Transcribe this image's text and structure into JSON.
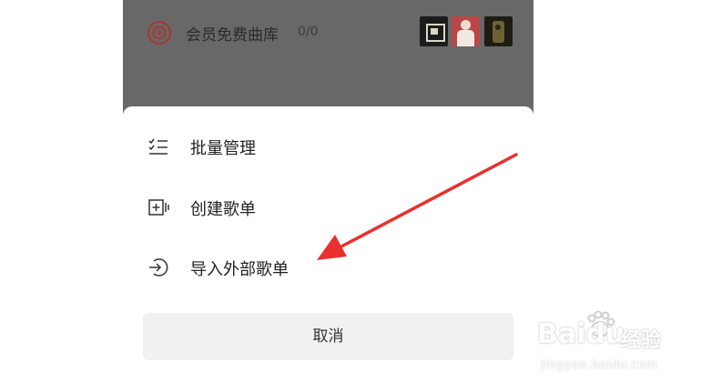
{
  "library": {
    "title": "会员免费曲库",
    "count": "0/0",
    "disc_icon": "vinyl-disc-icon",
    "accent_color": "#d9453a"
  },
  "menu": {
    "items": [
      {
        "label": "批量管理",
        "icon": "batch-manage-checklist-icon"
      },
      {
        "label": "创建歌单",
        "icon": "create-playlist-icon"
      },
      {
        "label": "导入外部歌单",
        "icon": "import-playlist-icon"
      }
    ],
    "cancel_label": "取消"
  },
  "annotation": {
    "arrow_color": "#e8302f"
  },
  "watermark": {
    "brand": "Baidu",
    "name": "经验",
    "url": "jingyan.baidu.com"
  }
}
